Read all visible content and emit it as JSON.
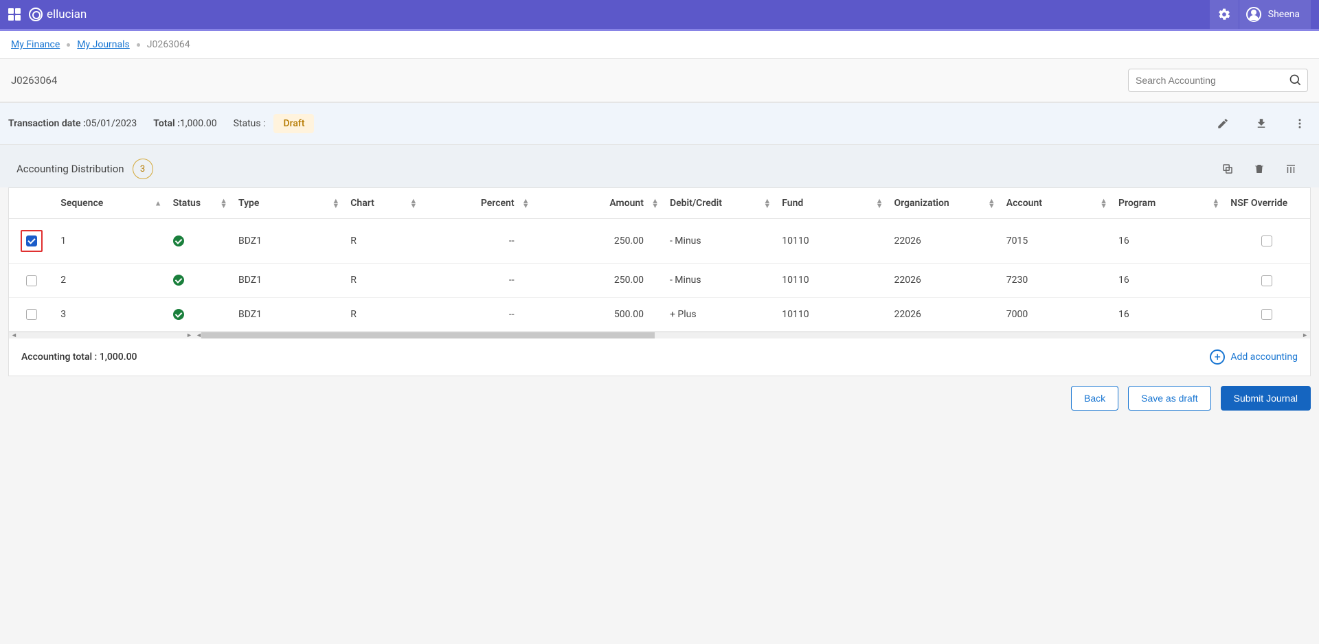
{
  "header": {
    "brand": "ellucian",
    "username": "Sheena"
  },
  "breadcrumb": {
    "items": [
      {
        "label": "My Finance",
        "link": true
      },
      {
        "label": "My Journals",
        "link": true
      },
      {
        "label": "J0263064",
        "link": false
      }
    ]
  },
  "page": {
    "title": "J0263064",
    "search_placeholder": "Search Accounting"
  },
  "meta": {
    "trans_label": "Transaction date :",
    "trans_value": "05/01/2023",
    "total_label": "Total :",
    "total_value": "1,000.00",
    "status_label": "Status :",
    "status_value": "Draft"
  },
  "section": {
    "title": "Accounting Distribution",
    "count": "3"
  },
  "table": {
    "columns": {
      "sequence": "Sequence",
      "status": "Status",
      "type": "Type",
      "chart": "Chart",
      "percent": "Percent",
      "amount": "Amount",
      "debit_credit": "Debit/Credit",
      "fund": "Fund",
      "organization": "Organization",
      "account": "Account",
      "program": "Program",
      "nsf": "NSF Override"
    },
    "rows": [
      {
        "checked": true,
        "highlight": true,
        "sequence": "1",
        "type": "BDZ1",
        "chart": "R",
        "percent": "--",
        "amount": "250.00",
        "debit_credit": "- Minus",
        "fund": "10110",
        "organization": "22026",
        "account": "7015",
        "program": "16",
        "nsf": false
      },
      {
        "checked": false,
        "highlight": false,
        "sequence": "2",
        "type": "BDZ1",
        "chart": "R",
        "percent": "--",
        "amount": "250.00",
        "debit_credit": "- Minus",
        "fund": "10110",
        "organization": "22026",
        "account": "7230",
        "program": "16",
        "nsf": false
      },
      {
        "checked": false,
        "highlight": false,
        "sequence": "3",
        "type": "BDZ1",
        "chart": "R",
        "percent": "--",
        "amount": "500.00",
        "debit_credit": "+ Plus",
        "fund": "10110",
        "organization": "22026",
        "account": "7000",
        "program": "16",
        "nsf": false
      }
    ]
  },
  "footer": {
    "total_label": "Accounting total : 1,000.00",
    "add_label": "Add accounting"
  },
  "actions": {
    "back": "Back",
    "save_draft": "Save as draft",
    "submit": "Submit Journal"
  }
}
